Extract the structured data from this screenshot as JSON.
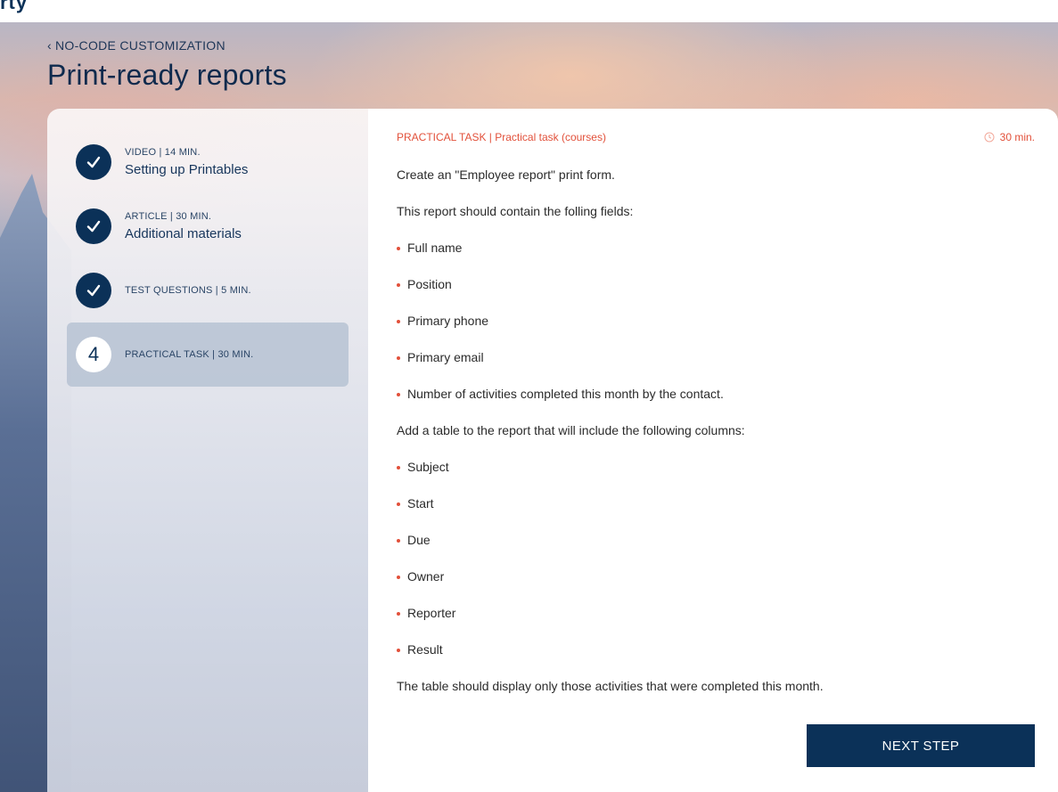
{
  "header": {
    "logo_fragment": "rty"
  },
  "breadcrumb": {
    "label": "NO-CODE CUSTOMIZATION"
  },
  "page": {
    "title": "Print-ready reports"
  },
  "steps": [
    {
      "meta": "VIDEO | 14 MIN.",
      "name": "Setting up Printables",
      "status": "completed",
      "icon": "check-icon"
    },
    {
      "meta": "ARTICLE | 30 MIN.",
      "name": "Additional materials",
      "status": "completed",
      "icon": "check-icon"
    },
    {
      "meta": "TEST QUESTIONS | 5 MIN.",
      "name": "",
      "status": "completed",
      "icon": "check-icon"
    },
    {
      "meta": "PRACTICAL TASK | 30 MIN.",
      "name": "",
      "status": "active",
      "number": "4"
    }
  ],
  "task": {
    "label": "PRACTICAL TASK | Practical task (courses)",
    "duration": "30 min.",
    "intro": "Create an \"Employee report\" print form.",
    "fields_intro": "This report should contain the folling fields:",
    "fields": [
      "Full name",
      "Position",
      "Primary phone",
      "Primary email",
      "Number of activities completed this month by the contact."
    ],
    "table_intro": "Add a table to the report that will include the following columns:",
    "columns": [
      "Subject",
      "Start",
      "Due",
      "Owner",
      "Reporter",
      "Result"
    ],
    "outro": "The table should display only those activities that were completed this month."
  },
  "actions": {
    "next_label": "NEXT STEP"
  },
  "colors": {
    "primary": "#0b3158",
    "accent": "#e2503a"
  }
}
